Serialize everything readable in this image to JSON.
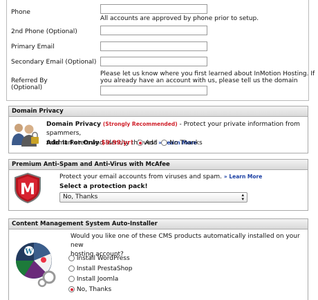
{
  "account": {
    "phone_label": "Phone",
    "phone_note": "All accounts are approved by phone prior to setup.",
    "phone2_label": "2nd Phone (Optional)",
    "email_label": "Primary Email",
    "email2_label": "Secondary Email (Optional)",
    "referred_label_1": "Referred By",
    "referred_label_2": "(Optional)",
    "referred_note_1": "Please let us know where you first learned about InMotion Hosting.  If",
    "referred_note_2": "you already have an account with us, please tell us the domain name."
  },
  "domain_privacy": {
    "title": "Domain Privacy",
    "name": "Domain Privacy",
    "recommended": "(Strongly Recommended)",
    "desc_1": " - Protect your private information from spammers,",
    "desc_2": "telemarketers and identity thieves!",
    "learn_more": "» Learn More",
    "price_label": "Add It For Only ",
    "price": "$9.99/yr!",
    "opt_add": "Add",
    "opt_no": "No Thanks",
    "colors": {
      "accent": "#d0202a"
    }
  },
  "antispam": {
    "title": "Premium Anti-Spam and Anti-Virus with McAfee",
    "desc": "Protect your email accounts from viruses and spam.",
    "learn_more": "» Learn More",
    "select_label": "Select a protection pack!",
    "select_value": "No, Thanks",
    "icon": "mcafee-shield-icon"
  },
  "cms": {
    "title": "Content Management System Auto-Installer",
    "question_1": "Would you like one of these CMS products automatically installed on your new",
    "question_2": "hosting account?",
    "options": [
      "Install WordPress",
      "Install PrestaShop",
      "Install Joomla",
      "No, Thanks"
    ],
    "selected": 3,
    "icon": "cms-wheel-icon"
  }
}
